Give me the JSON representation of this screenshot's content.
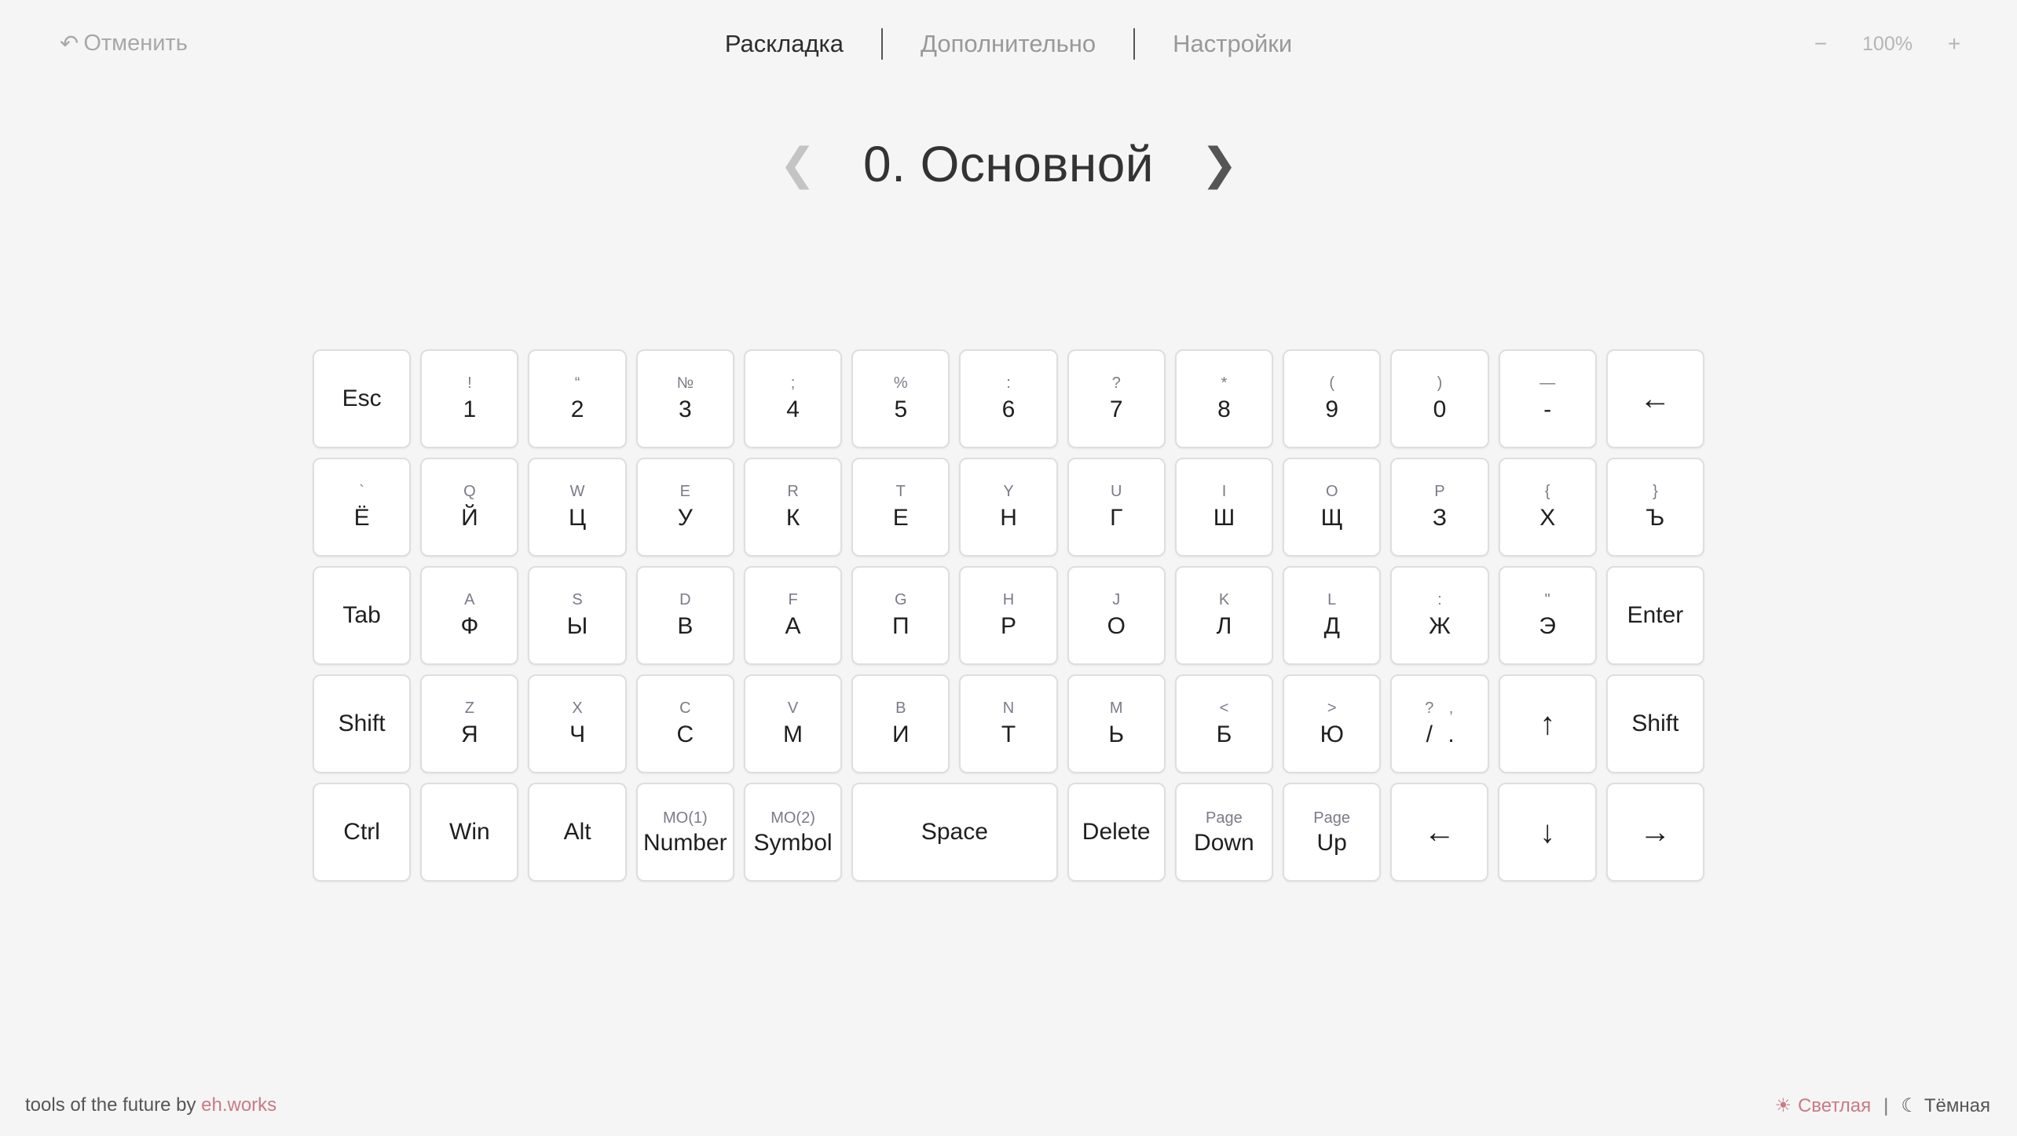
{
  "header": {
    "undo_icon": "↶",
    "undo_label": "Отменить",
    "tabs": [
      {
        "label": "Раскладка",
        "active": true
      },
      {
        "label": "Дополнительно",
        "active": false
      },
      {
        "label": "Настройки",
        "active": false
      }
    ],
    "zoom": {
      "minus": "−",
      "value": "100%",
      "plus": "+"
    }
  },
  "layer": {
    "prev_arrow": "❮",
    "title": "0. Основной",
    "next_arrow": "❯"
  },
  "keyboard": {
    "rows": [
      [
        {
          "type": "single",
          "label": "Esc"
        },
        {
          "type": "dual",
          "sec": "!",
          "pri": "1"
        },
        {
          "type": "dual",
          "sec": "“",
          "pri": "2"
        },
        {
          "type": "dual",
          "sec": "№",
          "pri": "3"
        },
        {
          "type": "dual",
          "sec": ";",
          "pri": "4"
        },
        {
          "type": "dual",
          "sec": "%",
          "pri": "5"
        },
        {
          "type": "dual",
          "sec": ":",
          "pri": "6"
        },
        {
          "type": "dual",
          "sec": "?",
          "pri": "7"
        },
        {
          "type": "dual",
          "sec": "*",
          "pri": "8"
        },
        {
          "type": "dual",
          "sec": "(",
          "pri": "9"
        },
        {
          "type": "dual",
          "sec": ")",
          "pri": "0"
        },
        {
          "type": "dual",
          "sec": "—",
          "pri": "-"
        },
        {
          "type": "big",
          "label": "←"
        }
      ],
      [
        {
          "type": "dual",
          "sec": "`",
          "pri": "Ё"
        },
        {
          "type": "dual",
          "sec": "Q",
          "pri": "Й"
        },
        {
          "type": "dual",
          "sec": "W",
          "pri": "Ц"
        },
        {
          "type": "dual",
          "sec": "E",
          "pri": "У"
        },
        {
          "type": "dual",
          "sec": "R",
          "pri": "К"
        },
        {
          "type": "dual",
          "sec": "T",
          "pri": "Е"
        },
        {
          "type": "dual",
          "sec": "Y",
          "pri": "Н"
        },
        {
          "type": "dual",
          "sec": "U",
          "pri": "Г"
        },
        {
          "type": "dual",
          "sec": "I",
          "pri": "Ш"
        },
        {
          "type": "dual",
          "sec": "O",
          "pri": "Щ"
        },
        {
          "type": "dual",
          "sec": "P",
          "pri": "З"
        },
        {
          "type": "dual",
          "sec": "{",
          "pri": "Х"
        },
        {
          "type": "dual",
          "sec": "}",
          "pri": "Ъ"
        }
      ],
      [
        {
          "type": "single",
          "label": "Tab"
        },
        {
          "type": "dual",
          "sec": "A",
          "pri": "Ф"
        },
        {
          "type": "dual",
          "sec": "S",
          "pri": "Ы"
        },
        {
          "type": "dual",
          "sec": "D",
          "pri": "В"
        },
        {
          "type": "dual",
          "sec": "F",
          "pri": "А"
        },
        {
          "type": "dual",
          "sec": "G",
          "pri": "П"
        },
        {
          "type": "dual",
          "sec": "H",
          "pri": "Р"
        },
        {
          "type": "dual",
          "sec": "J",
          "pri": "О"
        },
        {
          "type": "dual",
          "sec": "K",
          "pri": "Л"
        },
        {
          "type": "dual",
          "sec": "L",
          "pri": "Д"
        },
        {
          "type": "dual",
          "sec": ":",
          "pri": "Ж"
        },
        {
          "type": "dual",
          "sec": "\"",
          "pri": "Э"
        },
        {
          "type": "single",
          "label": "Enter"
        }
      ],
      [
        {
          "type": "single",
          "label": "Shift"
        },
        {
          "type": "dual",
          "sec": "Z",
          "pri": "Я"
        },
        {
          "type": "dual",
          "sec": "X",
          "pri": "Ч"
        },
        {
          "type": "dual",
          "sec": "C",
          "pri": "С"
        },
        {
          "type": "dual",
          "sec": "V",
          "pri": "М"
        },
        {
          "type": "dual",
          "sec": "B",
          "pri": "И"
        },
        {
          "type": "dual",
          "sec": "N",
          "pri": "Т"
        },
        {
          "type": "dual",
          "sec": "M",
          "pri": "Ь"
        },
        {
          "type": "dual",
          "sec": "<",
          "pri": "Б"
        },
        {
          "type": "dual",
          "sec": ">",
          "pri": "Ю"
        },
        {
          "type": "pair",
          "left_sec": "?",
          "left_pri": "/",
          "right_sec": ",",
          "right_pri": "."
        },
        {
          "type": "big",
          "label": "↑"
        },
        {
          "type": "single",
          "label": "Shift"
        }
      ],
      [
        {
          "type": "single",
          "label": "Ctrl"
        },
        {
          "type": "single",
          "label": "Win"
        },
        {
          "type": "single",
          "label": "Alt"
        },
        {
          "type": "mod",
          "sec": "MO(1)",
          "pri": "Number"
        },
        {
          "type": "mod",
          "sec": "MO(2)",
          "pri": "Symbol"
        },
        {
          "type": "single",
          "label": "Space",
          "wide": true
        },
        {
          "type": "single",
          "label": "Delete"
        },
        {
          "type": "mod",
          "sec": "Page",
          "pri": "Down"
        },
        {
          "type": "mod",
          "sec": "Page",
          "pri": "Up"
        },
        {
          "type": "big",
          "label": "←"
        },
        {
          "type": "big",
          "label": "↓"
        },
        {
          "type": "big",
          "label": "→"
        }
      ]
    ]
  },
  "footer": {
    "prefix": "tools of the future by ",
    "link": "eh.works",
    "theme_light_icon": "☀",
    "theme_light": "Светлая",
    "separator": "|",
    "theme_dark_icon": "☾",
    "theme_dark": "Тёмная"
  },
  "colors": {
    "background": "#f5f5f5",
    "accent": "#c97a86",
    "key_border": "#dedede"
  }
}
